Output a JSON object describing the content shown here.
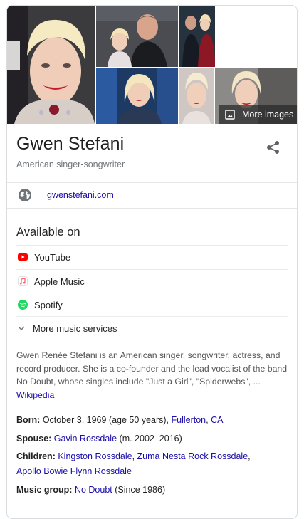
{
  "panel": {
    "more_images_label": "More images",
    "title": "Gwen Stefani",
    "subtitle": "American singer-songwriter",
    "website": "gwenstefani.com"
  },
  "available_on": {
    "heading": "Available on",
    "services": [
      {
        "label": "YouTube",
        "icon": "youtube-icon",
        "color": "#ff0000"
      },
      {
        "label": "Apple Music",
        "icon": "apple-music-icon",
        "color": "#fb5c74"
      },
      {
        "label": "Spotify",
        "icon": "spotify-icon",
        "color": "#1ed760"
      }
    ],
    "more_label": "More music services"
  },
  "description": {
    "text": "Gwen Renée Stefani is an American singer, songwriter, actress, and record producer. She is a co-founder and the lead vocalist of the band No Doubt, whose singles include \"Just a Girl\", \"Spiderwebs\", ...",
    "source": "Wikipedia"
  },
  "facts": {
    "born_label": "Born:",
    "born_value": "October 3, 1969 (age 50 years),",
    "born_place_city": "Fullerton",
    "born_place_sep": ",",
    "born_place_state": "CA",
    "spouse_label": "Spouse:",
    "spouse_link": "Gavin Rossdale",
    "spouse_extra": "(m. 2002–2016)",
    "children_label": "Children:",
    "child_1": "Kingston Rossdale",
    "child_sep_1": ",",
    "child_2": "Zuma Nesta Rock Rossdale",
    "child_sep_2": ",",
    "child_3": "Apollo Bowie Flynn Rossdale",
    "group_label": "Music group:",
    "group_link": "No Doubt",
    "group_extra": "(Since 1986)"
  },
  "colors": {
    "link": "#1a0dab",
    "text": "#222222",
    "secondary": "#70757a"
  }
}
